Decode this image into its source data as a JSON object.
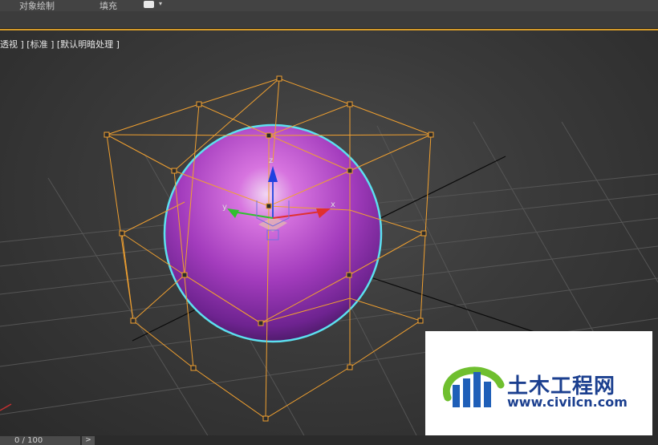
{
  "menubar": {
    "object_paint": "对象绘制",
    "fill": "填充"
  },
  "viewport": {
    "label": "透视 ] [标准 ] [默认明暗处理 ]",
    "gizmo_axes": {
      "x": "x",
      "y": "y",
      "z": "z"
    }
  },
  "timeline": {
    "frame": "0 / 100",
    "next": ">"
  },
  "watermark": {
    "title": "土木工程网",
    "url": "www.civilcn.com"
  },
  "colors": {
    "sphere": "#a040c0",
    "selection_outline": "#5ce0f0",
    "lattice": "#f0a030",
    "accent": "#d49a2a"
  }
}
